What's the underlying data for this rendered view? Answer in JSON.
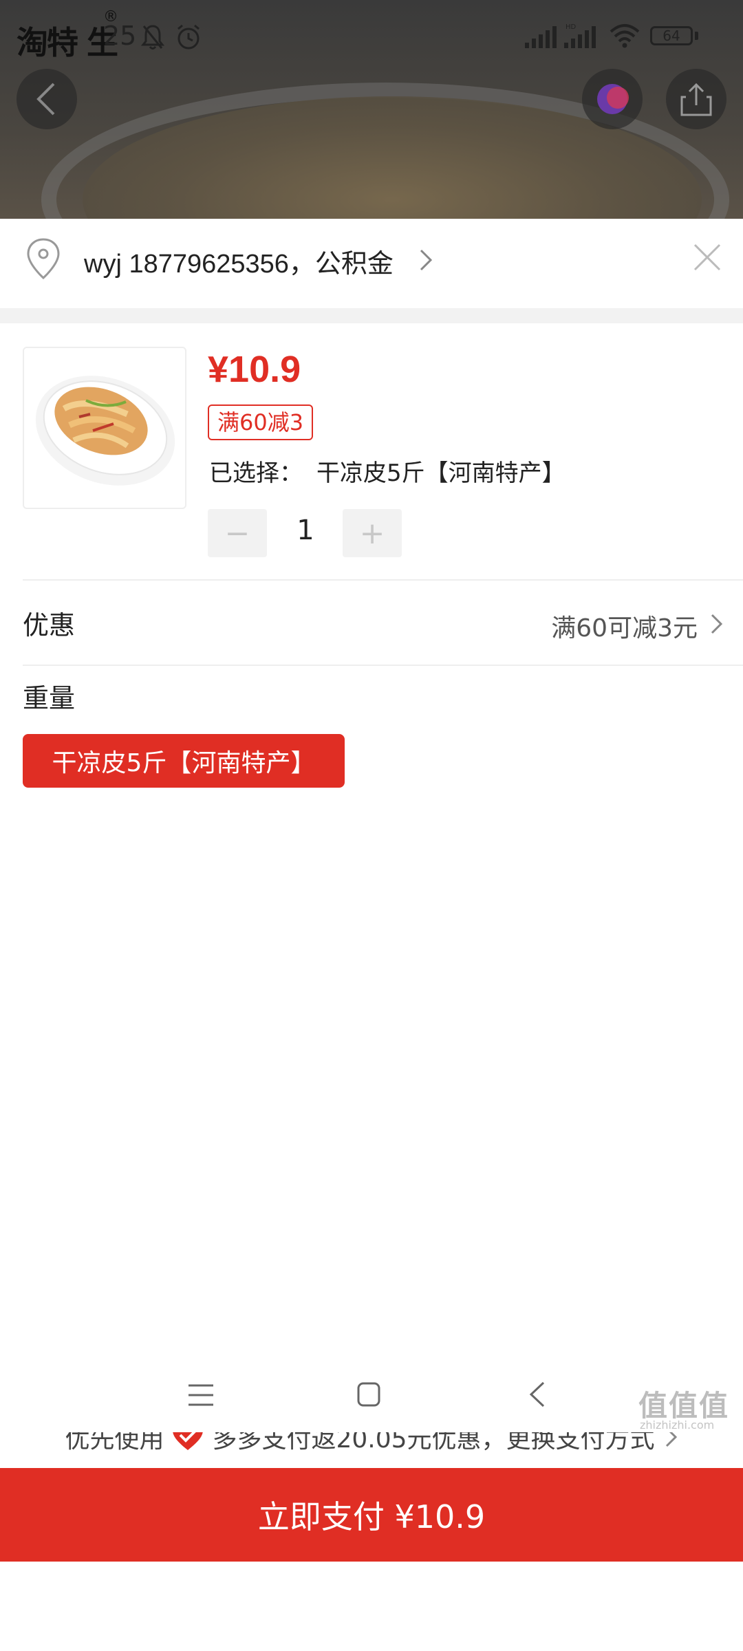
{
  "status_bar": {
    "brand": "淘特 生",
    "brand_mark": "®",
    "time": "25",
    "battery": "64"
  },
  "address": {
    "text": "wyj 18779625356，公积金"
  },
  "product": {
    "price": "¥10.9",
    "promo_tag": "满60减3",
    "selected_label": "已选择：",
    "selected_value": "干凉皮5斤【河南特产】",
    "quantity": "1",
    "minus": "−",
    "plus": "+"
  },
  "discount": {
    "label": "优惠",
    "value": "满60可减3元"
  },
  "weight": {
    "label": "重量",
    "option": "干凉皮5斤【河南特产】"
  },
  "payment": {
    "hint_prefix": "优先使用",
    "hint_main": "多多支付返20.05元优惠，更换支付方式",
    "button": "立即支付 ¥10.9"
  },
  "watermark": {
    "main": "值值值",
    "sub": "zhizhizhi.com"
  },
  "colors": {
    "accent": "#e02e24",
    "divider": "#f2f2f2"
  }
}
